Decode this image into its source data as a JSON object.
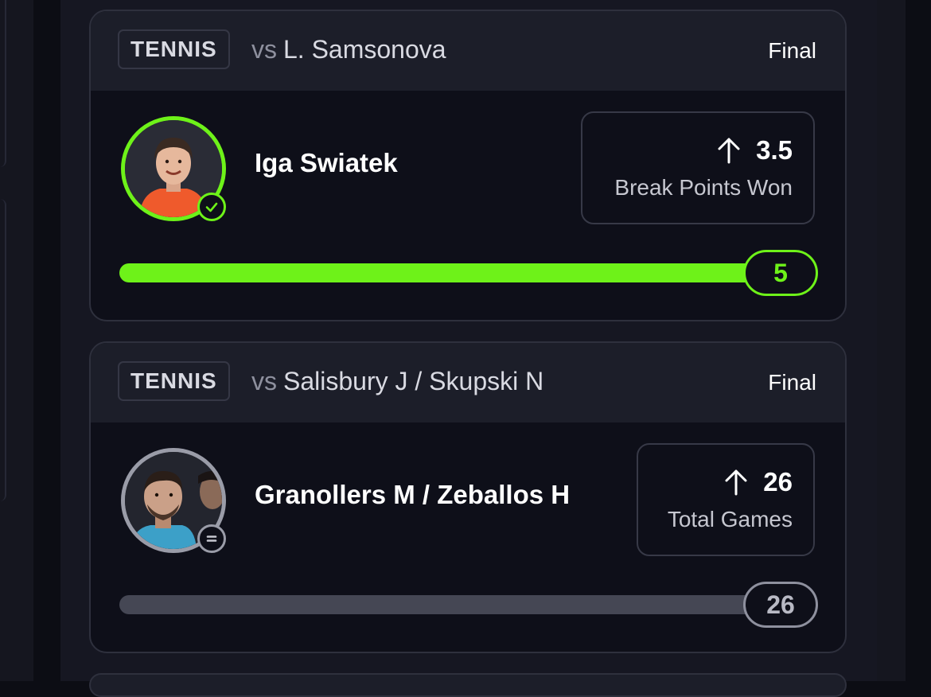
{
  "cards": [
    {
      "sport": "TENNIS",
      "vs_prefix": "vs",
      "opponent": "L. Samsonova",
      "status": "Final",
      "player": "Iga Swiatek",
      "stat_value": "3.5",
      "stat_label": "Break Points Won",
      "direction": "up",
      "result_value": "5",
      "progress_fraction": 1.0,
      "outcome": "won",
      "accent": "#6ef219"
    },
    {
      "sport": "TENNIS",
      "vs_prefix": "vs",
      "opponent": "Salisbury J / Skupski N",
      "status": "Final",
      "player": "Granollers M / Zeballos H",
      "stat_value": "26",
      "stat_label": "Total Games",
      "direction": "up",
      "result_value": "26",
      "progress_fraction": 1.0,
      "outcome": "push",
      "accent": "#9a9ca8"
    }
  ],
  "icons": {
    "arrow": "arrow-up-icon",
    "won": "check-circle-icon",
    "push": "equals-circle-icon"
  }
}
